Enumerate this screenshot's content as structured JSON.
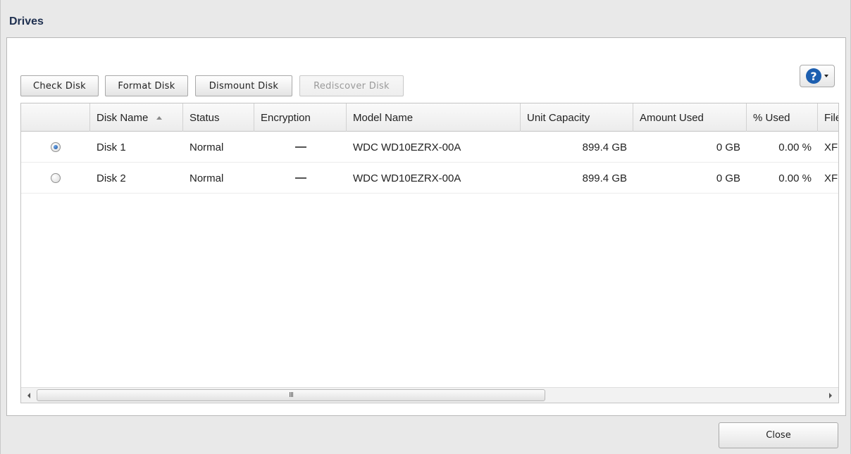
{
  "dialog": {
    "title": "Drives"
  },
  "toolbar": {
    "check_disk": "Check Disk",
    "format_disk": "Format Disk",
    "dismount_disk": "Dismount Disk",
    "rediscover_disk": "Rediscover Disk"
  },
  "help": {
    "icon": "help-icon",
    "symbol": "?"
  },
  "table": {
    "headers": {
      "select": "",
      "disk_name": "Disk Name",
      "status": "Status",
      "encryption": "Encryption",
      "model_name": "Model Name",
      "unit_capacity": "Unit Capacity",
      "amount_used": "Amount Used",
      "percent_used": "% Used",
      "file_system": "File System"
    },
    "sort": {
      "column": "Disk Name",
      "direction": "ascending"
    },
    "rows": [
      {
        "selected": true,
        "disk_name": "Disk 1",
        "status": "Normal",
        "encryption": "—",
        "model_name": "WDC WD10EZRX-00A",
        "unit_capacity": "899.4 GB",
        "amount_used": "0 GB",
        "percent_used": "0.00 %",
        "file_system": "XFS"
      },
      {
        "selected": false,
        "disk_name": "Disk 2",
        "status": "Normal",
        "encryption": "—",
        "model_name": "WDC WD10EZRX-00A",
        "unit_capacity": "899.4 GB",
        "amount_used": "0 GB",
        "percent_used": "0.00 %",
        "file_system": "XFS"
      }
    ]
  },
  "scrollbar": {
    "grip": "III"
  },
  "footer": {
    "close_label": "Close"
  },
  "colors": {
    "title": "#1e2f4f",
    "help_blue": "#1d5fb0",
    "radio_selected": "#1b4f9c"
  }
}
